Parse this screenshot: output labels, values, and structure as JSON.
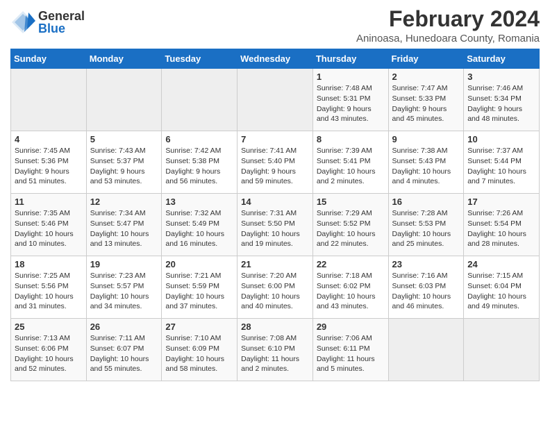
{
  "logo": {
    "general": "General",
    "blue": "Blue"
  },
  "title": "February 2024",
  "location": "Aninoasa, Hunedoara County, Romania",
  "days_header": [
    "Sunday",
    "Monday",
    "Tuesday",
    "Wednesday",
    "Thursday",
    "Friday",
    "Saturday"
  ],
  "weeks": [
    [
      {
        "day": "",
        "info": ""
      },
      {
        "day": "",
        "info": ""
      },
      {
        "day": "",
        "info": ""
      },
      {
        "day": "",
        "info": ""
      },
      {
        "day": "1",
        "info": "Sunrise: 7:48 AM\nSunset: 5:31 PM\nDaylight: 9 hours\nand 43 minutes."
      },
      {
        "day": "2",
        "info": "Sunrise: 7:47 AM\nSunset: 5:33 PM\nDaylight: 9 hours\nand 45 minutes."
      },
      {
        "day": "3",
        "info": "Sunrise: 7:46 AM\nSunset: 5:34 PM\nDaylight: 9 hours\nand 48 minutes."
      }
    ],
    [
      {
        "day": "4",
        "info": "Sunrise: 7:45 AM\nSunset: 5:36 PM\nDaylight: 9 hours\nand 51 minutes."
      },
      {
        "day": "5",
        "info": "Sunrise: 7:43 AM\nSunset: 5:37 PM\nDaylight: 9 hours\nand 53 minutes."
      },
      {
        "day": "6",
        "info": "Sunrise: 7:42 AM\nSunset: 5:38 PM\nDaylight: 9 hours\nand 56 minutes."
      },
      {
        "day": "7",
        "info": "Sunrise: 7:41 AM\nSunset: 5:40 PM\nDaylight: 9 hours\nand 59 minutes."
      },
      {
        "day": "8",
        "info": "Sunrise: 7:39 AM\nSunset: 5:41 PM\nDaylight: 10 hours\nand 2 minutes."
      },
      {
        "day": "9",
        "info": "Sunrise: 7:38 AM\nSunset: 5:43 PM\nDaylight: 10 hours\nand 4 minutes."
      },
      {
        "day": "10",
        "info": "Sunrise: 7:37 AM\nSunset: 5:44 PM\nDaylight: 10 hours\nand 7 minutes."
      }
    ],
    [
      {
        "day": "11",
        "info": "Sunrise: 7:35 AM\nSunset: 5:46 PM\nDaylight: 10 hours\nand 10 minutes."
      },
      {
        "day": "12",
        "info": "Sunrise: 7:34 AM\nSunset: 5:47 PM\nDaylight: 10 hours\nand 13 minutes."
      },
      {
        "day": "13",
        "info": "Sunrise: 7:32 AM\nSunset: 5:49 PM\nDaylight: 10 hours\nand 16 minutes."
      },
      {
        "day": "14",
        "info": "Sunrise: 7:31 AM\nSunset: 5:50 PM\nDaylight: 10 hours\nand 19 minutes."
      },
      {
        "day": "15",
        "info": "Sunrise: 7:29 AM\nSunset: 5:52 PM\nDaylight: 10 hours\nand 22 minutes."
      },
      {
        "day": "16",
        "info": "Sunrise: 7:28 AM\nSunset: 5:53 PM\nDaylight: 10 hours\nand 25 minutes."
      },
      {
        "day": "17",
        "info": "Sunrise: 7:26 AM\nSunset: 5:54 PM\nDaylight: 10 hours\nand 28 minutes."
      }
    ],
    [
      {
        "day": "18",
        "info": "Sunrise: 7:25 AM\nSunset: 5:56 PM\nDaylight: 10 hours\nand 31 minutes."
      },
      {
        "day": "19",
        "info": "Sunrise: 7:23 AM\nSunset: 5:57 PM\nDaylight: 10 hours\nand 34 minutes."
      },
      {
        "day": "20",
        "info": "Sunrise: 7:21 AM\nSunset: 5:59 PM\nDaylight: 10 hours\nand 37 minutes."
      },
      {
        "day": "21",
        "info": "Sunrise: 7:20 AM\nSunset: 6:00 PM\nDaylight: 10 hours\nand 40 minutes."
      },
      {
        "day": "22",
        "info": "Sunrise: 7:18 AM\nSunset: 6:02 PM\nDaylight: 10 hours\nand 43 minutes."
      },
      {
        "day": "23",
        "info": "Sunrise: 7:16 AM\nSunset: 6:03 PM\nDaylight: 10 hours\nand 46 minutes."
      },
      {
        "day": "24",
        "info": "Sunrise: 7:15 AM\nSunset: 6:04 PM\nDaylight: 10 hours\nand 49 minutes."
      }
    ],
    [
      {
        "day": "25",
        "info": "Sunrise: 7:13 AM\nSunset: 6:06 PM\nDaylight: 10 hours\nand 52 minutes."
      },
      {
        "day": "26",
        "info": "Sunrise: 7:11 AM\nSunset: 6:07 PM\nDaylight: 10 hours\nand 55 minutes."
      },
      {
        "day": "27",
        "info": "Sunrise: 7:10 AM\nSunset: 6:09 PM\nDaylight: 10 hours\nand 58 minutes."
      },
      {
        "day": "28",
        "info": "Sunrise: 7:08 AM\nSunset: 6:10 PM\nDaylight: 11 hours\nand 2 minutes."
      },
      {
        "day": "29",
        "info": "Sunrise: 7:06 AM\nSunset: 6:11 PM\nDaylight: 11 hours\nand 5 minutes."
      },
      {
        "day": "",
        "info": ""
      },
      {
        "day": "",
        "info": ""
      }
    ]
  ]
}
